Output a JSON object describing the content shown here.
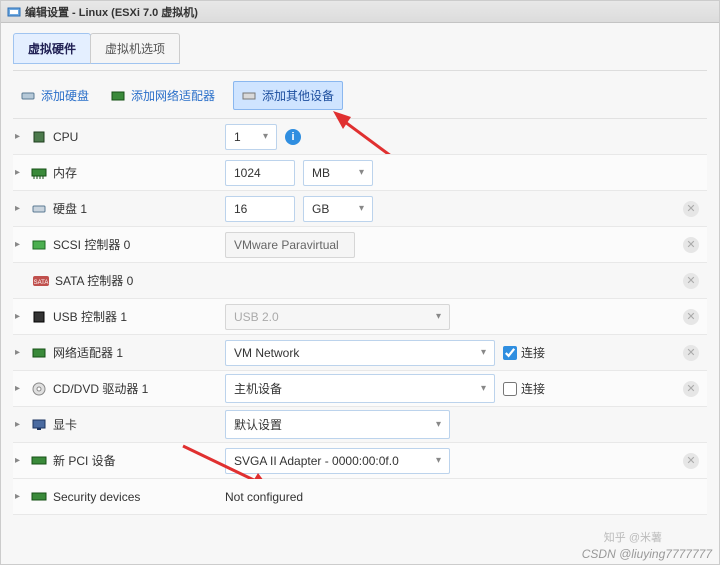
{
  "window": {
    "title": "编辑设置 - Linux (ESXi 7.0 虚拟机)"
  },
  "tabs": {
    "hardware": "虚拟硬件",
    "options": "虚拟机选项"
  },
  "toolbar": {
    "add_disk": "添加硬盘",
    "add_nic": "添加网络适配器",
    "add_other": "添加其他设备"
  },
  "rows": {
    "cpu": {
      "label": "CPU",
      "value": "1"
    },
    "memory": {
      "label": "内存",
      "value": "1024",
      "unit": "MB"
    },
    "disk1": {
      "label": "硬盘 1",
      "value": "16",
      "unit": "GB"
    },
    "scsi0": {
      "label": "SCSI 控制器 0",
      "value": "VMware Paravirtual"
    },
    "sata0": {
      "label": "SATA 控制器 0"
    },
    "usb1": {
      "label": "USB 控制器 1",
      "value": "USB 2.0"
    },
    "nic1": {
      "label": "网络适配器 1",
      "value": "VM Network",
      "connect": "连接"
    },
    "cd1": {
      "label": "CD/DVD 驱动器 1",
      "value": "主机设备",
      "connect": "连接"
    },
    "video": {
      "label": "显卡",
      "value": "默认设置"
    },
    "pci": {
      "label": "新 PCI 设备",
      "value": "SVGA II Adapter - 0000:00:0f.0"
    },
    "sec": {
      "label": "Security devices",
      "value": "Not configured"
    }
  },
  "watermark": {
    "line1": "知乎 @米薯",
    "line2": "CSDN @liuying7777777"
  }
}
